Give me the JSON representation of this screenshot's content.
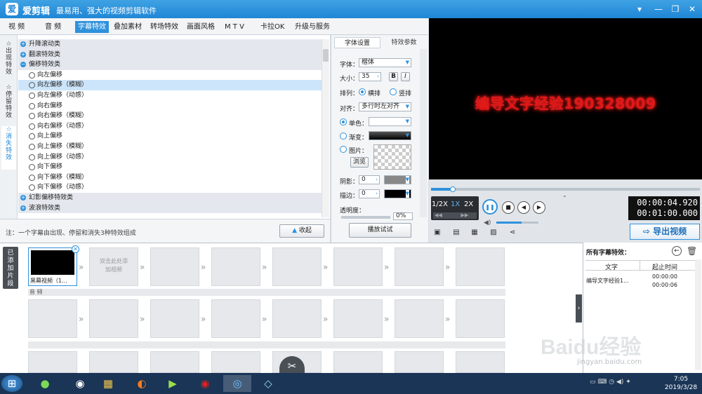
{
  "app": {
    "logo_glyph": "爱",
    "name": "爱剪辑",
    "slogan": "最易用、强大的视频剪辑软件"
  },
  "window_controls": [
    "▾",
    "—",
    "❐",
    "✕"
  ],
  "menu": {
    "items": [
      "视 频",
      "音 频",
      "字幕特效",
      "叠加素材",
      "转场特效",
      "画面风格",
      "M T V",
      "卡拉OK",
      "升级与服务"
    ],
    "active": "字幕特效"
  },
  "side_tabs": [
    {
      "glyph": "☆",
      "label": "出现特效"
    },
    {
      "glyph": "☆",
      "label": "停留特效"
    },
    {
      "glyph": "☆",
      "label": "消失特效"
    }
  ],
  "effects": [
    {
      "type": "cat",
      "sign": "+",
      "label": "升降滚动类"
    },
    {
      "type": "cat",
      "sign": "+",
      "label": "翻滚特效类"
    },
    {
      "type": "cat",
      "sign": "−",
      "label": "偏移特效类"
    },
    {
      "type": "item",
      "label": "向左偏移"
    },
    {
      "type": "item",
      "label": "向左偏移（模糊）",
      "selected": true
    },
    {
      "type": "item",
      "label": "向左偏移（动感）"
    },
    {
      "type": "item",
      "label": "向右偏移"
    },
    {
      "type": "item",
      "label": "向右偏移（模糊）"
    },
    {
      "type": "item",
      "label": "向右偏移（动感）"
    },
    {
      "type": "item",
      "label": "向上偏移"
    },
    {
      "type": "item",
      "label": "向上偏移（模糊）"
    },
    {
      "type": "item",
      "label": "向上偏移（动感）"
    },
    {
      "type": "item",
      "label": "向下偏移"
    },
    {
      "type": "item",
      "label": "向下偏移（模糊）"
    },
    {
      "type": "item",
      "label": "向下偏移（动感）"
    },
    {
      "type": "cat",
      "sign": "+",
      "label": "幻影偏移特效类"
    },
    {
      "type": "cat",
      "sign": "+",
      "label": "波浪特效类"
    }
  ],
  "left_bottom": {
    "note": "注：一个字幕由出现、停留和消失3种特效组成",
    "collapse_label": "收起"
  },
  "font_panel": {
    "tabs": [
      "字体设置",
      "特效参数"
    ],
    "font_label": "字体：",
    "font_value": "楷体",
    "size_label": "大小：",
    "size_value": "35",
    "bold": "B",
    "italic": "I",
    "layout_label": "排列：",
    "horizontal": "横排",
    "vertical": "竖排",
    "align_label": "对齐：",
    "align_value": "多行时左对齐",
    "solid_label": "单色：",
    "gradient_label": "渐变：",
    "image_label": "图片：",
    "browse": "浏览",
    "shadow_label": "阴影：",
    "shadow_value": "0",
    "stroke_label": "描边：",
    "stroke_value": "0",
    "opacity_label": "透明度：",
    "opacity_value": "0%",
    "play_test": "播放试试"
  },
  "preview": {
    "caption": "编导文字经验190328009"
  },
  "player": {
    "speeds": [
      "1/2X",
      "1X",
      "2X"
    ],
    "active_speed": "1X",
    "current_time": "00:00:04.920",
    "total_time": "00:01:00.000",
    "progress": 0.08,
    "volume": 0.6,
    "export_label": "导出视频",
    "buttons": [
      "❚❚",
      "■",
      "◀",
      "▶"
    ],
    "tool_icons": [
      "▣",
      "▤",
      "▦",
      "▨",
      "⋖"
    ]
  },
  "timeline": {
    "side_label": "已添加片段",
    "first_clip": "黑幕视频（1...",
    "add_hint": "双击此处添加视频",
    "audio_label": "音 频",
    "scissors": "✂"
  },
  "subtitle_list": {
    "title": "所有字幕特效：",
    "col_text": "文字",
    "col_time": "起止时间",
    "row_text": "编导文字经验1...",
    "row_start": "00:00:00",
    "row_end": "00:00:06"
  },
  "taskbar": {
    "icons": [
      "⊞",
      "●",
      "◉",
      "▦",
      "◐",
      "▶",
      "◉",
      "◎",
      "◇"
    ],
    "time": "7:05",
    "date": "2019/3/28"
  },
  "watermark": {
    "text": "Baidu经验",
    "sub": "jingyan.baidu.com"
  }
}
